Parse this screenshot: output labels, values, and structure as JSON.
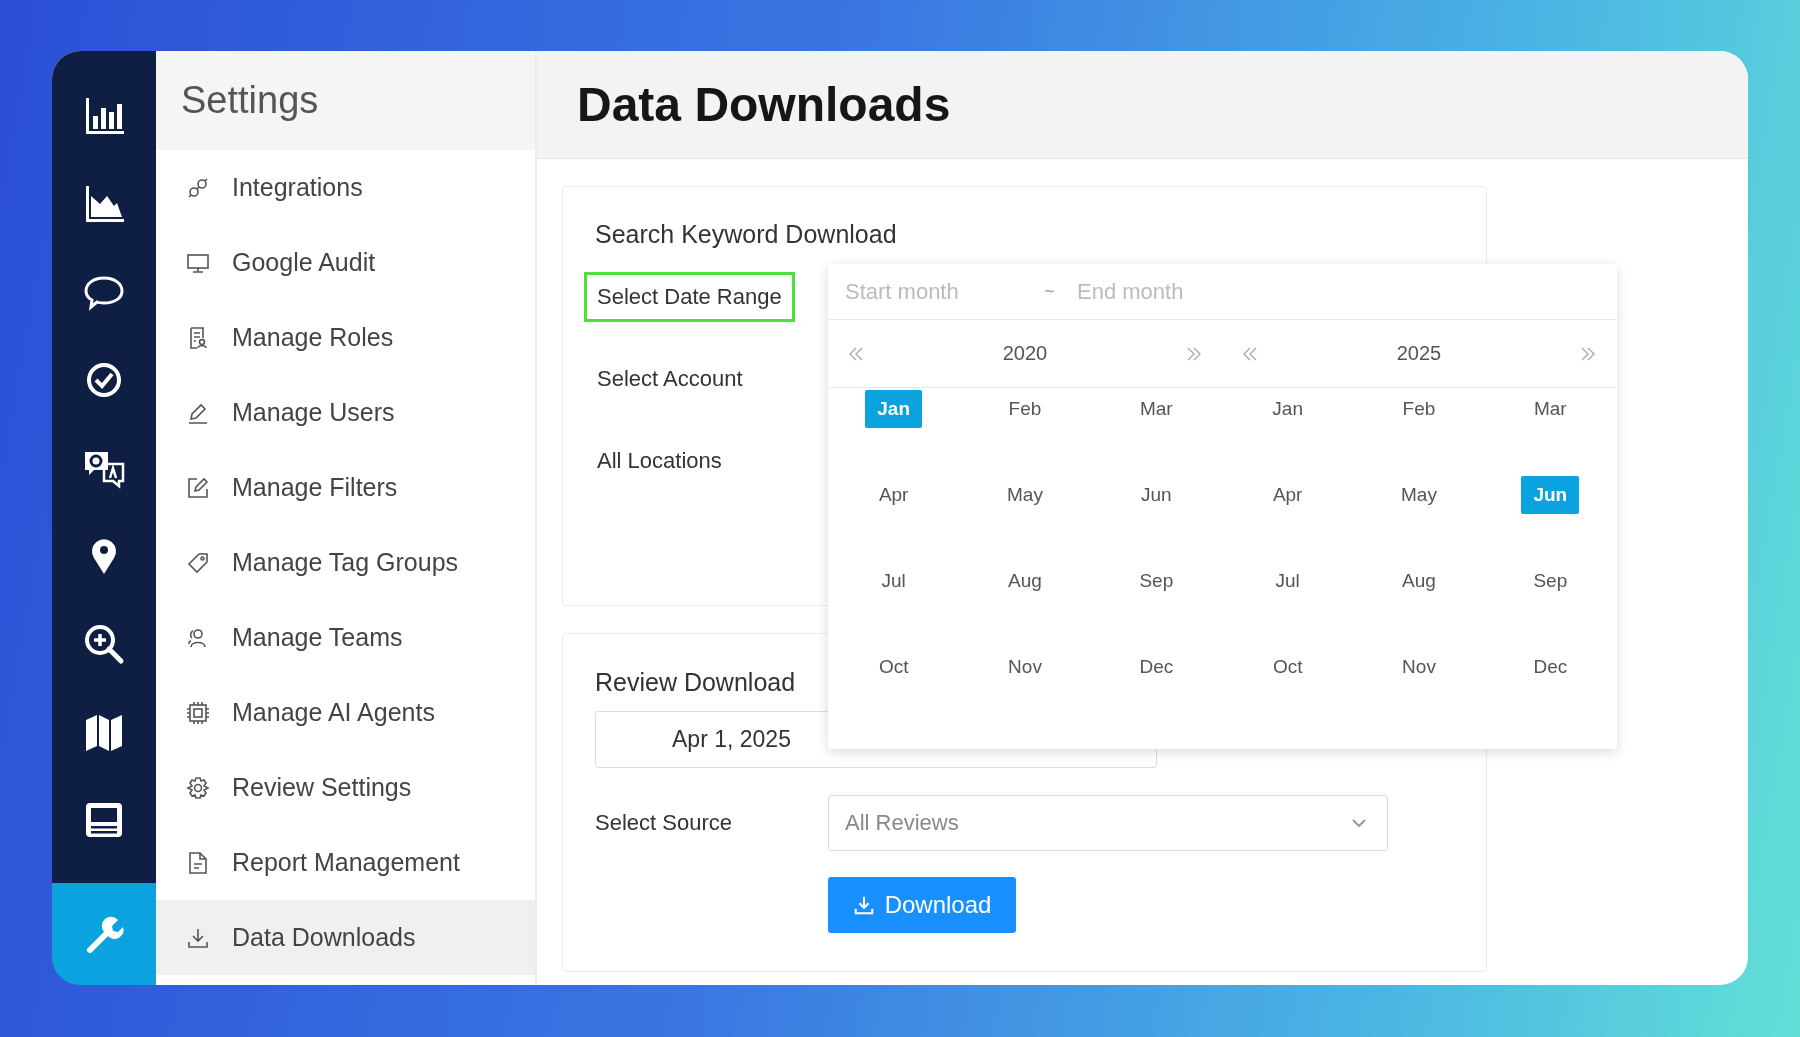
{
  "rail": {
    "items": [
      {
        "selected": false
      },
      {
        "selected": false
      },
      {
        "selected": false
      },
      {
        "selected": false
      },
      {
        "selected": false
      },
      {
        "selected": false
      },
      {
        "selected": false
      },
      {
        "selected": false
      },
      {
        "selected": false
      },
      {
        "selected": true
      }
    ]
  },
  "settings": {
    "title": "Settings",
    "items": [
      {
        "label": "Integrations",
        "selected": false
      },
      {
        "label": "Google Audit",
        "selected": false
      },
      {
        "label": "Manage Roles",
        "selected": false
      },
      {
        "label": "Manage Users",
        "selected": false
      },
      {
        "label": "Manage Filters",
        "selected": false
      },
      {
        "label": "Manage Tag Groups",
        "selected": false
      },
      {
        "label": "Manage Teams",
        "selected": false
      },
      {
        "label": "Manage AI Agents",
        "selected": false
      },
      {
        "label": "Review Settings",
        "selected": false
      },
      {
        "label": "Report Management",
        "selected": false
      },
      {
        "label": "Data Downloads",
        "selected": true
      }
    ]
  },
  "page_title": "Data Downloads",
  "keyword_card": {
    "title": "Search Keyword Download",
    "fields": [
      {
        "label": "Select Date Range",
        "highlighted": true
      },
      {
        "label": "Select Account",
        "highlighted": false
      },
      {
        "label": "All Locations",
        "highlighted": false
      }
    ]
  },
  "month_picker": {
    "start_placeholder": "Start month",
    "separator": "~",
    "end_placeholder": "End month",
    "panels": [
      {
        "year": "2020",
        "months": [
          {
            "label": "Jan",
            "selected": true
          },
          {
            "label": "Feb",
            "selected": false
          },
          {
            "label": "Mar",
            "selected": false
          },
          {
            "label": "Apr",
            "selected": false
          },
          {
            "label": "May",
            "selected": false
          },
          {
            "label": "Jun",
            "selected": false
          },
          {
            "label": "Jul",
            "selected": false
          },
          {
            "label": "Aug",
            "selected": false
          },
          {
            "label": "Sep",
            "selected": false
          },
          {
            "label": "Oct",
            "selected": false
          },
          {
            "label": "Nov",
            "selected": false
          },
          {
            "label": "Dec",
            "selected": false
          }
        ]
      },
      {
        "year": "2025",
        "months": [
          {
            "label": "Jan",
            "selected": false
          },
          {
            "label": "Feb",
            "selected": false
          },
          {
            "label": "Mar",
            "selected": false
          },
          {
            "label": "Apr",
            "selected": false
          },
          {
            "label": "May",
            "selected": false
          },
          {
            "label": "Jun",
            "selected": true
          },
          {
            "label": "Jul",
            "selected": false
          },
          {
            "label": "Aug",
            "selected": false
          },
          {
            "label": "Sep",
            "selected": false
          },
          {
            "label": "Oct",
            "selected": false
          },
          {
            "label": "Nov",
            "selected": false
          },
          {
            "label": "Dec",
            "selected": false
          }
        ]
      }
    ]
  },
  "review_card": {
    "title": "Review Download",
    "start_date": "Apr 1, 2025",
    "source_label": "Select Source",
    "source_value": "All Reviews",
    "download_button": "Download"
  }
}
